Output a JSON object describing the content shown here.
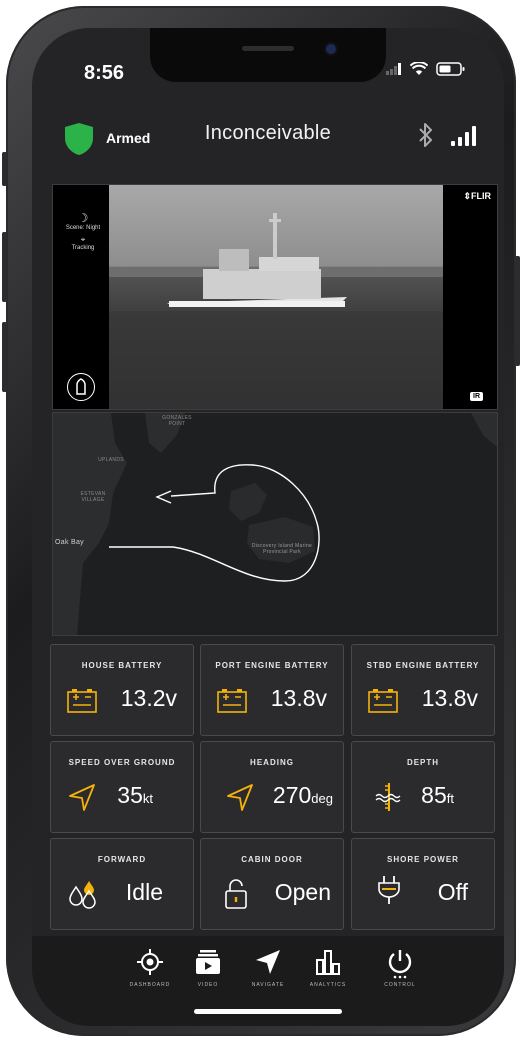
{
  "status_bar": {
    "time": "8:56"
  },
  "header": {
    "armed_label": "Armed",
    "vessel_name": "Inconceivable"
  },
  "video": {
    "scene_label": "Scene: Night",
    "tracking_label": "Tracking",
    "brand": "FLIR",
    "mode_badge": "IR"
  },
  "map": {
    "labels": [
      "GONZALES POINT",
      "UPLANDS",
      "ESTEVAN VILLAGE",
      "Oak Bay",
      "Discovery Island Marine Provincial Park"
    ]
  },
  "tiles": [
    {
      "title": "HOUSE BATTERY",
      "value": "13.2",
      "unit": "v",
      "icon": "battery-icon"
    },
    {
      "title": "PORT ENGINE BATTERY",
      "value": "13.8",
      "unit": "v",
      "icon": "battery-icon"
    },
    {
      "title": "STBD ENGINE BATTERY",
      "value": "13.8",
      "unit": "v",
      "icon": "battery-icon"
    },
    {
      "title": "SPEED OVER GROUND",
      "value": "35",
      "unit": "kt",
      "icon": "navigation-arrow-icon"
    },
    {
      "title": "HEADING",
      "value": "270",
      "unit": "deg",
      "icon": "navigation-arrow-icon"
    },
    {
      "title": "DEPTH",
      "value": "85",
      "unit": "ft",
      "icon": "depth-gauge-icon"
    },
    {
      "title": "FORWARD",
      "value": "Idle",
      "unit": "",
      "icon": "droplets-icon"
    },
    {
      "title": "CABIN DOOR",
      "value": "Open",
      "unit": "",
      "icon": "padlock-icon"
    },
    {
      "title": "SHORE POWER",
      "value": "Off",
      "unit": "",
      "icon": "power-plug-icon"
    }
  ],
  "nav": [
    {
      "label": "DASHBOARD",
      "icon": "crosshair-icon"
    },
    {
      "label": "VIDEO",
      "icon": "video-icon"
    },
    {
      "label": "NAVIGATE",
      "icon": "navigate-arrow-icon"
    },
    {
      "label": "ANALYTICS",
      "icon": "analytics-icon"
    },
    {
      "label": "CONTROL",
      "icon": "power-icon"
    }
  ],
  "colors": {
    "accent": "#f5b20a",
    "armed_green": "#2bb34a",
    "background": "#242426"
  }
}
